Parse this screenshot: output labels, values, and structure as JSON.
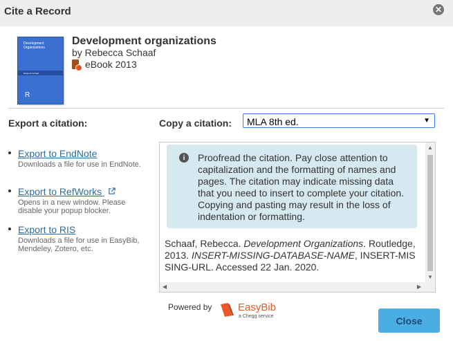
{
  "dialog": {
    "title": "Cite a Record",
    "close_icon": "close-icon"
  },
  "record": {
    "cover_title": "Development Organizations",
    "cover_author": "Rebecca Schaaf",
    "title": "Development organizations",
    "author": "by Rebecca Schaaf",
    "format_icon": "ebook-icon",
    "format": "eBook 2013"
  },
  "export": {
    "heading": "Export a citation:",
    "items": [
      {
        "label": "Export to EndNote",
        "description": "Downloads a file for use in EndNote."
      },
      {
        "label": "Export to RefWorks",
        "description": "Opens in a new window. Please disable your popup blocker.",
        "icon": "external-link-icon"
      },
      {
        "label": "Export to RIS",
        "description": "Downloads a file for use in EasyBib, Mendeley, Zotero, etc."
      }
    ]
  },
  "copy": {
    "heading": "Copy a citation:",
    "selected_style": "MLA 8th ed."
  },
  "notice": {
    "icon": "info-icon",
    "text": "Proofread the citation. Pay close attention to capitalization and the formatting of names and pages. The citation may indicate missing data that you need to insert to complete your citation. Copying and pasting may result in the loss of indentation or formatting."
  },
  "citation": {
    "part1": "Schaaf, Rebecca. ",
    "title": "Development Organizations",
    "part2": ". Routledge, 2013. ",
    "database": "INSERT-MISSING-DATABASE-NAME",
    "part3": ", INSERT-MISSING-URL. Accessed 22 Jan. 2020."
  },
  "footer": {
    "powered_by": "Powered by",
    "brand": "EasyBib",
    "brand_sub": "a Chegg service",
    "close_label": "Close"
  },
  "colors": {
    "accent": "#4aaee4",
    "link": "#2a6aa0",
    "notice_bg": "#d6e8f0",
    "brand": "#e85a2b"
  }
}
